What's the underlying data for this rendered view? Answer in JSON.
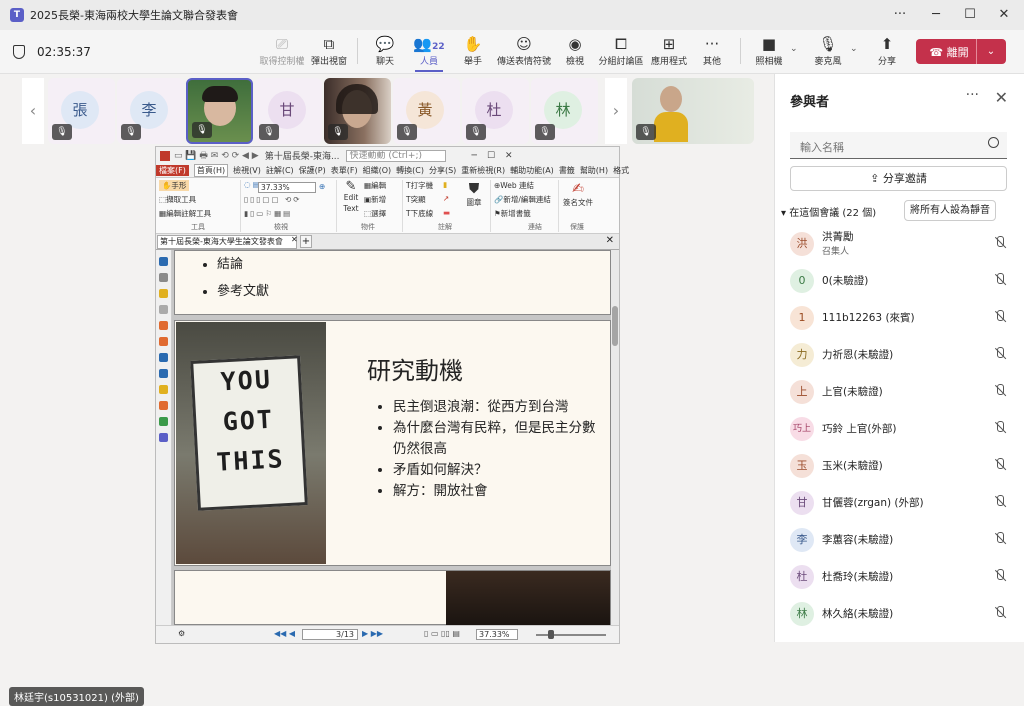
{
  "window": {
    "title": "2025長榮-東海兩校大學生論文聯合發表會",
    "more": "···",
    "minimize": "─",
    "maximize": "☐",
    "close": "✕"
  },
  "meeting": {
    "timer": "02:35:37"
  },
  "toolbar": {
    "items": [
      {
        "label": "取得控制權",
        "icon": "cast"
      },
      {
        "label": "彈出視窗",
        "icon": "popout"
      },
      {
        "label": "聊天",
        "icon": "chat"
      },
      {
        "label": "人員",
        "icon": "people",
        "count": "22"
      },
      {
        "label": "舉手",
        "icon": "hand"
      },
      {
        "label": "傳送表情符號",
        "icon": "emoji"
      },
      {
        "label": "檢視",
        "icon": "view"
      },
      {
        "label": "分組討論區",
        "icon": "rooms"
      },
      {
        "label": "應用程式",
        "icon": "apps"
      },
      {
        "label": "其他",
        "icon": "more"
      },
      {
        "label": "照相機",
        "icon": "camera"
      },
      {
        "label": "麥克風",
        "icon": "mic"
      },
      {
        "label": "分享",
        "icon": "share"
      }
    ],
    "leave_label": "離開"
  },
  "tiles": [
    {
      "initial": "張",
      "bg": "#dfe8f5",
      "fg": "#3a5a8c"
    },
    {
      "initial": "李",
      "bg": "#dfe8f5",
      "fg": "#3a5a8c"
    },
    {
      "initial": "",
      "video": true
    },
    {
      "initial": "甘",
      "bg": "#ecdff0",
      "fg": "#6b4a7a"
    },
    {
      "initial": "",
      "video": true
    },
    {
      "initial": "黃",
      "bg": "#f5e6d8",
      "fg": "#8a5a2a"
    },
    {
      "initial": "杜",
      "bg": "#ecdff0",
      "fg": "#6b4a7a"
    },
    {
      "initial": "林",
      "bg": "#dff0e2",
      "fg": "#3b7a45"
    },
    {
      "initial": "",
      "video": true
    }
  ],
  "nav": {
    "prev": "‹",
    "next": "›"
  },
  "shared": {
    "app_title": "第十屆長榮-東海...",
    "app_search": "快速動動 (Ctrl+;)",
    "ribbon_tabs": [
      "檔案(F)",
      "首頁(H)",
      "檢視(V)",
      "註解(C)",
      "保護(P)",
      "表單(F)",
      "組織(O)",
      "轉換(C)",
      "分享(S)",
      "重新檢視(R)",
      "輔助功能(A)",
      "書籤",
      "幫助(H)",
      "格式"
    ],
    "ribbon": {
      "hand": "手形",
      "select_tool": "擷取工具",
      "edit_annot": "編輯註解工具",
      "group_tools": "工具",
      "zoom": "37.33%",
      "group_view": "檢視",
      "edit_text": "Edit Text",
      "edit": "編輯",
      "add": "新增",
      "choose": "選擇",
      "group_objects": "物件",
      "typewriter": "打字機",
      "highlight": "突顯",
      "underline": "下底線",
      "stamp": "圖章",
      "group_comment": "註解",
      "web_link": "Web 連結",
      "add_edit_link": "新增/編輯連結",
      "add_bookmark": "新增書籤",
      "group_links": "連結",
      "sign_doc": "簽名文件",
      "group_protect": "保護"
    },
    "doc_tab": "第十屆長榮-東海大學生論文發表會",
    "page_top_items": [
      "結論",
      "參考文獻"
    ],
    "slide_title": "研究動機",
    "slide_bullets": [
      "民主倒退浪潮：從西方到台灣",
      "為什麼台灣有民粹，但是民主分數仍然很高",
      "矛盾如何解決？",
      "解方：開放社會"
    ],
    "photo_lines": [
      "YOU",
      "GOT",
      "THIS"
    ],
    "status": {
      "page": "3/13",
      "zoom": "37.33%"
    }
  },
  "presenter_label": "林廷宇(s10531021) (外部)",
  "panel": {
    "title": "參與者",
    "search_placeholder": "輸入名稱",
    "invite_label": "分享邀請",
    "section_label": "在這個會議 (22 個)",
    "mute_all_label": "將所有人設為靜音",
    "people": [
      {
        "initial": "洪",
        "name": "洪菁勵",
        "role": "召集人",
        "bg": "#f5e0d8",
        "fg": "#9a4a2a"
      },
      {
        "initial": "0",
        "name": "0(未驗證)",
        "role": "",
        "bg": "#dff0e2",
        "fg": "#3b7a45"
      },
      {
        "initial": "1",
        "name": "111b12263 (來賓)",
        "role": "",
        "bg": "#f8e4d6",
        "fg": "#9a4a20"
      },
      {
        "initial": "力",
        "name": "力祈恩(未驗證)",
        "role": "",
        "bg": "#f5ecd5",
        "fg": "#8a6a20"
      },
      {
        "initial": "上",
        "name": "上官(未驗證)",
        "role": "",
        "bg": "#f5e0d8",
        "fg": "#9a4a2a"
      },
      {
        "initial": "巧上",
        "name": "巧鈴 上官(外部)",
        "role": "",
        "bg": "#f8dce6",
        "fg": "#a03a60"
      },
      {
        "initial": "玉",
        "name": "玉米(未驗證)",
        "role": "",
        "bg": "#f5e0d8",
        "fg": "#9a4a2a"
      },
      {
        "initial": "甘",
        "name": "甘儷蓉(zrgan) (外部)",
        "role": "",
        "bg": "#ecdff0",
        "fg": "#6b4a7a"
      },
      {
        "initial": "李",
        "name": "李蕙容(未驗證)",
        "role": "",
        "bg": "#dfe8f5",
        "fg": "#3a5a8c"
      },
      {
        "initial": "杜",
        "name": "杜喬玲(未驗證)",
        "role": "",
        "bg": "#ecdff0",
        "fg": "#6b4a7a"
      },
      {
        "initial": "林",
        "name": "林久絡(未驗證)",
        "role": "",
        "bg": "#dff0e2",
        "fg": "#3b7a45"
      }
    ]
  }
}
